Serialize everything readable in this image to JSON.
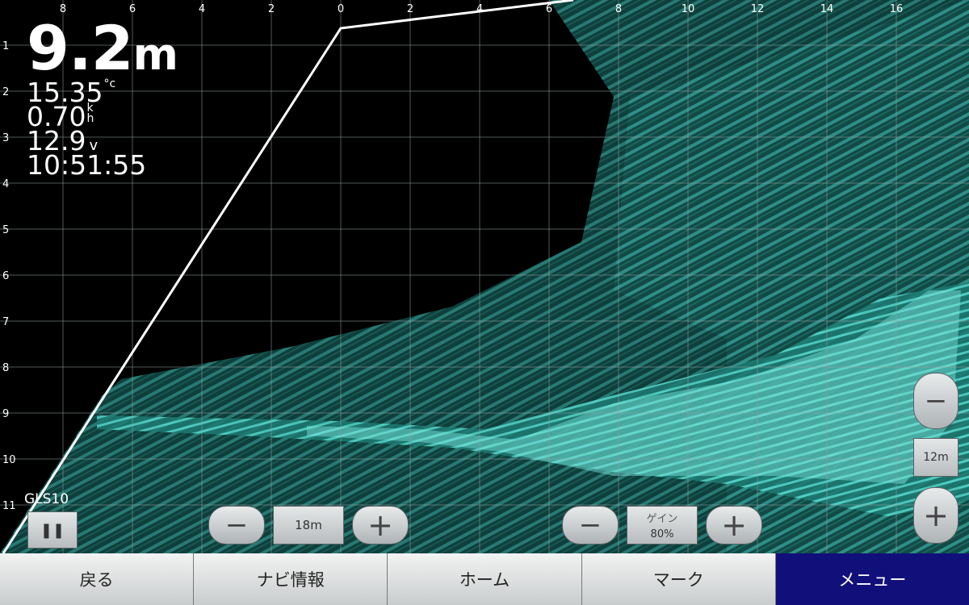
{
  "readouts": {
    "depth_value": "9.2",
    "depth_unit": "m",
    "water_temp": "15.35",
    "water_temp_unit": "°c",
    "speed": "0.70",
    "speed_unit_top": "k",
    "speed_unit_bottom": "h",
    "voltage": "12.9",
    "voltage_unit": "v",
    "time": "10:51:55"
  },
  "top_scale": [
    "8",
    "6",
    "4",
    "2",
    "0",
    "2",
    "4",
    "6",
    "8",
    "10",
    "12",
    "14",
    "16"
  ],
  "left_scale": [
    "1",
    "2",
    "3",
    "4",
    "5",
    "6",
    "7",
    "8",
    "9",
    "10",
    "11"
  ],
  "transducer": "GLS10",
  "controls": {
    "pause_icon": "pause-icon",
    "range_minus": "−",
    "range_value": "18m",
    "range_plus": "+",
    "gain_minus": "−",
    "gain_label": "ゲイン",
    "gain_value": "80%",
    "gain_plus": "+",
    "zoom_minus": "−",
    "zoom_value": "12m",
    "zoom_plus": "+"
  },
  "bottom_tabs": [
    {
      "label": "戻る",
      "active": false
    },
    {
      "label": "ナビ情報",
      "active": false
    },
    {
      "label": "ホーム",
      "active": false
    },
    {
      "label": "マーク",
      "active": false
    },
    {
      "label": "メニュー",
      "active": true
    }
  ],
  "colors": {
    "sonar_teal": "#3fc9bd",
    "active_tab": "#11107a"
  }
}
